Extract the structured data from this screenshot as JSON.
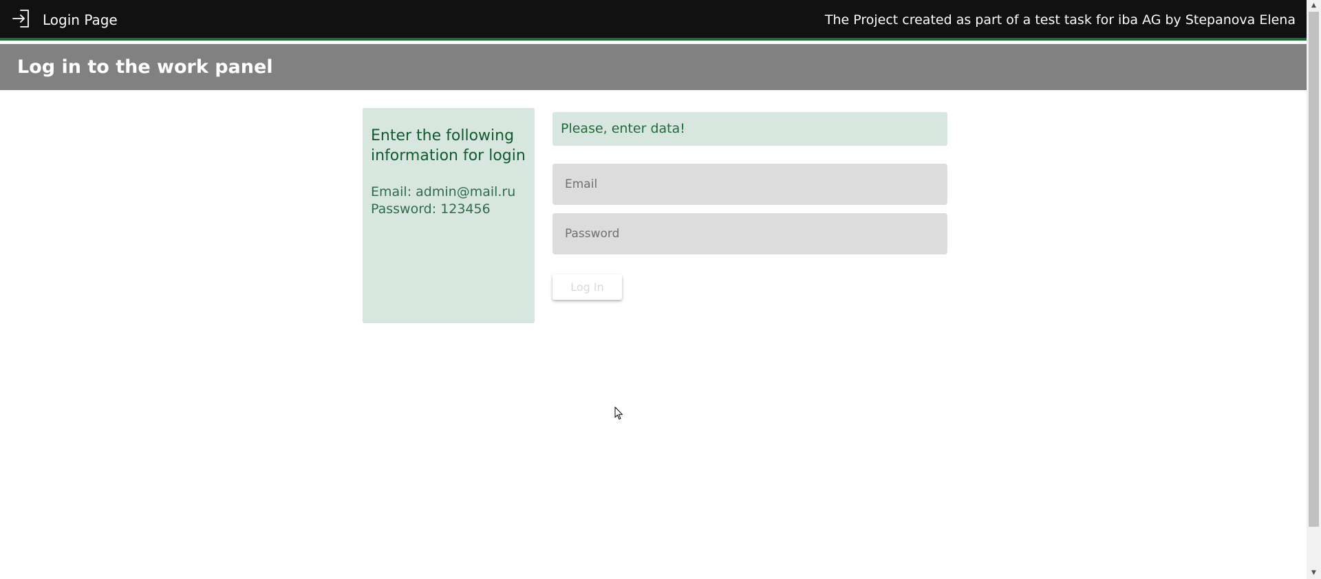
{
  "topbar": {
    "icon": "login-icon",
    "title": "Login Page",
    "credit": "The Project created as part of a test task for iba AG by Stepanova Elena"
  },
  "header": {
    "title": "Log in to the work panel"
  },
  "info_panel": {
    "heading": "Enter the following information for login",
    "email_line": "Email: admin@mail.ru",
    "password_line": "Password: 123456"
  },
  "form": {
    "alert": "Please, enter data!",
    "email_placeholder": "Email",
    "email_value": "",
    "password_placeholder": "Password",
    "password_value": "",
    "login_label": "Log In"
  },
  "colors": {
    "topbar": "#111111",
    "accent": "#1e6b3a",
    "header": "#818181",
    "panel": "#d7e7e0",
    "field": "#dcdcdc"
  }
}
